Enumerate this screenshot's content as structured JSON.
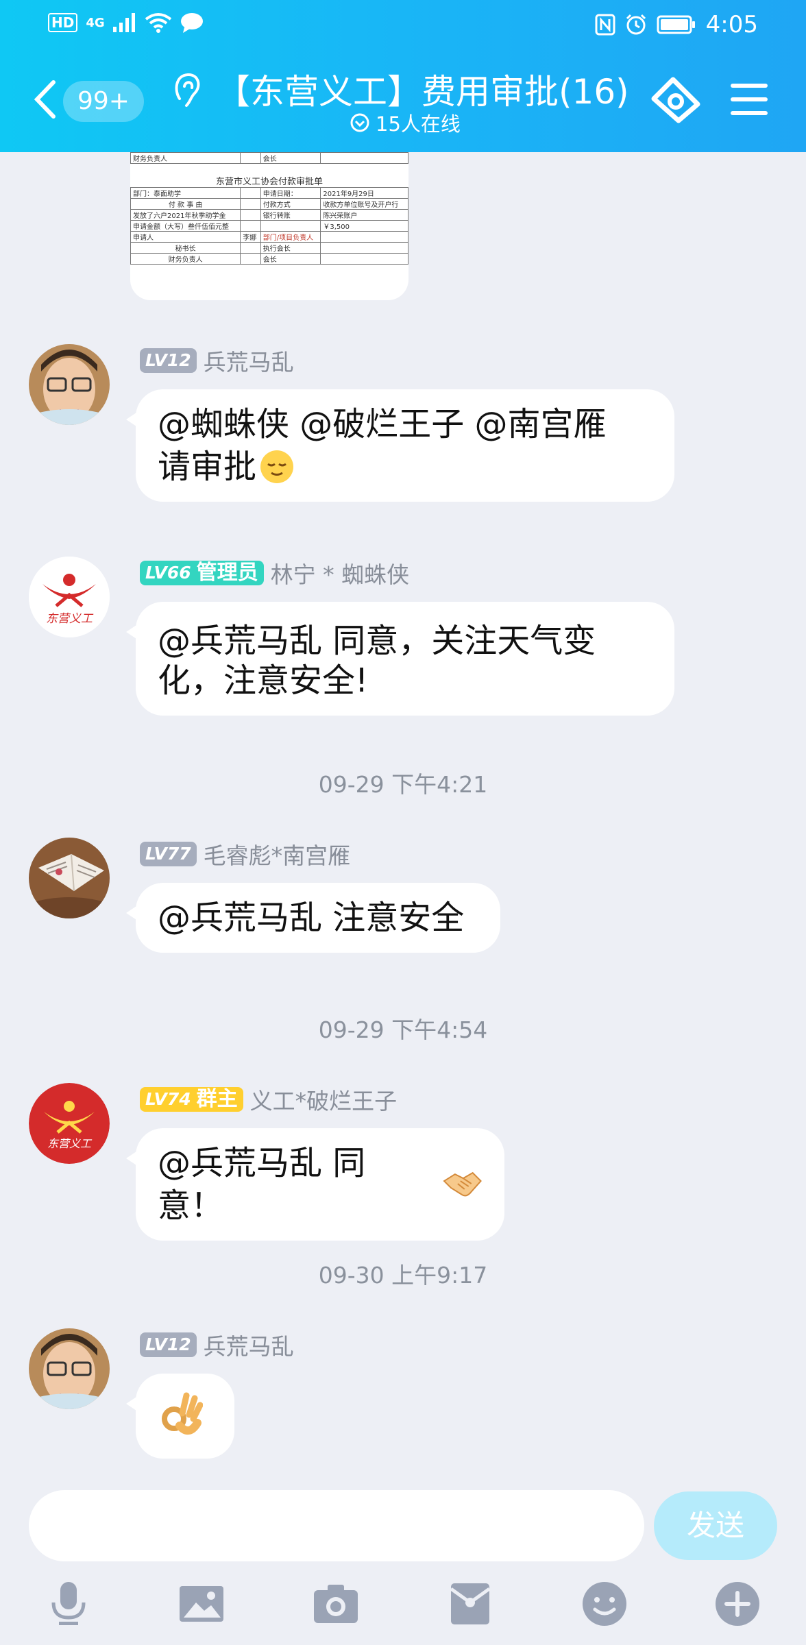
{
  "status_bar": {
    "time": "4:05",
    "network": "4G",
    "hd": "HD"
  },
  "header": {
    "back_badge": "99+",
    "title": "【东营义工】费用审批(16)",
    "online": "15人在线"
  },
  "sheet": {
    "top_row": [
      "财务负责人",
      "",
      "会长",
      ""
    ],
    "form_title": "东营市义工协会付款审批单",
    "rows": [
      [
        "部门：泰面助学",
        "",
        "申请日期：",
        "2021年9月29日"
      ],
      [
        "付 款 事 由",
        "",
        "付款方式",
        "收款方单位账号及开户行"
      ],
      [
        "发放了六户2021年秋季助学金",
        "",
        "银行转账",
        "陈兴荣账户"
      ],
      [
        "申请金额（大写）叁仟伍佰元整",
        "",
        "",
        "￥3,500"
      ],
      [
        "申请人",
        "李娜",
        "部门/项目负责人",
        ""
      ],
      [
        "秘书长",
        "",
        "执行会长",
        ""
      ],
      [
        "财务负责人",
        "",
        "会长",
        ""
      ]
    ]
  },
  "messages": [
    {
      "level": "LV12",
      "role": "",
      "name": "兵荒马乱",
      "text_lines": [
        "@蜘蛛侠 @破烂王子 @南宫雁",
        "请审批"
      ],
      "emoji": "relieved-face"
    },
    {
      "level": "LV66",
      "role": "管理员",
      "name": "林宁 * 蜘蛛侠",
      "text_lines": [
        "@兵荒马乱 同意，关注天气变",
        "化，注意安全!"
      ]
    },
    {
      "level": "LV77",
      "role": "",
      "name": "毛睿彪*南宫雁",
      "text_lines": [
        "@兵荒马乱 注意安全"
      ]
    },
    {
      "level": "LV74",
      "role": "群主",
      "name": "义工*破烂王子",
      "text_lines": [
        "@兵荒马乱 同意！"
      ],
      "emoji": "handshake"
    },
    {
      "level": "LV12",
      "role": "",
      "name": "兵荒马乱",
      "emoji": "ok-hand"
    }
  ],
  "timestamps": [
    "09-29 下午4:21",
    "09-29 下午4:54",
    "09-30 上午9:17"
  ],
  "input": {
    "placeholder": "",
    "send_label": "发送"
  },
  "toolbar": [
    "microphone-icon",
    "image-icon",
    "camera-icon",
    "red-packet-icon",
    "emoji-icon",
    "plus-icon"
  ],
  "colors": {
    "header_start": "#0fc8f4",
    "header_end": "#1fa6f4",
    "background": "#edeff5",
    "send_button": "#b5ebfb"
  }
}
